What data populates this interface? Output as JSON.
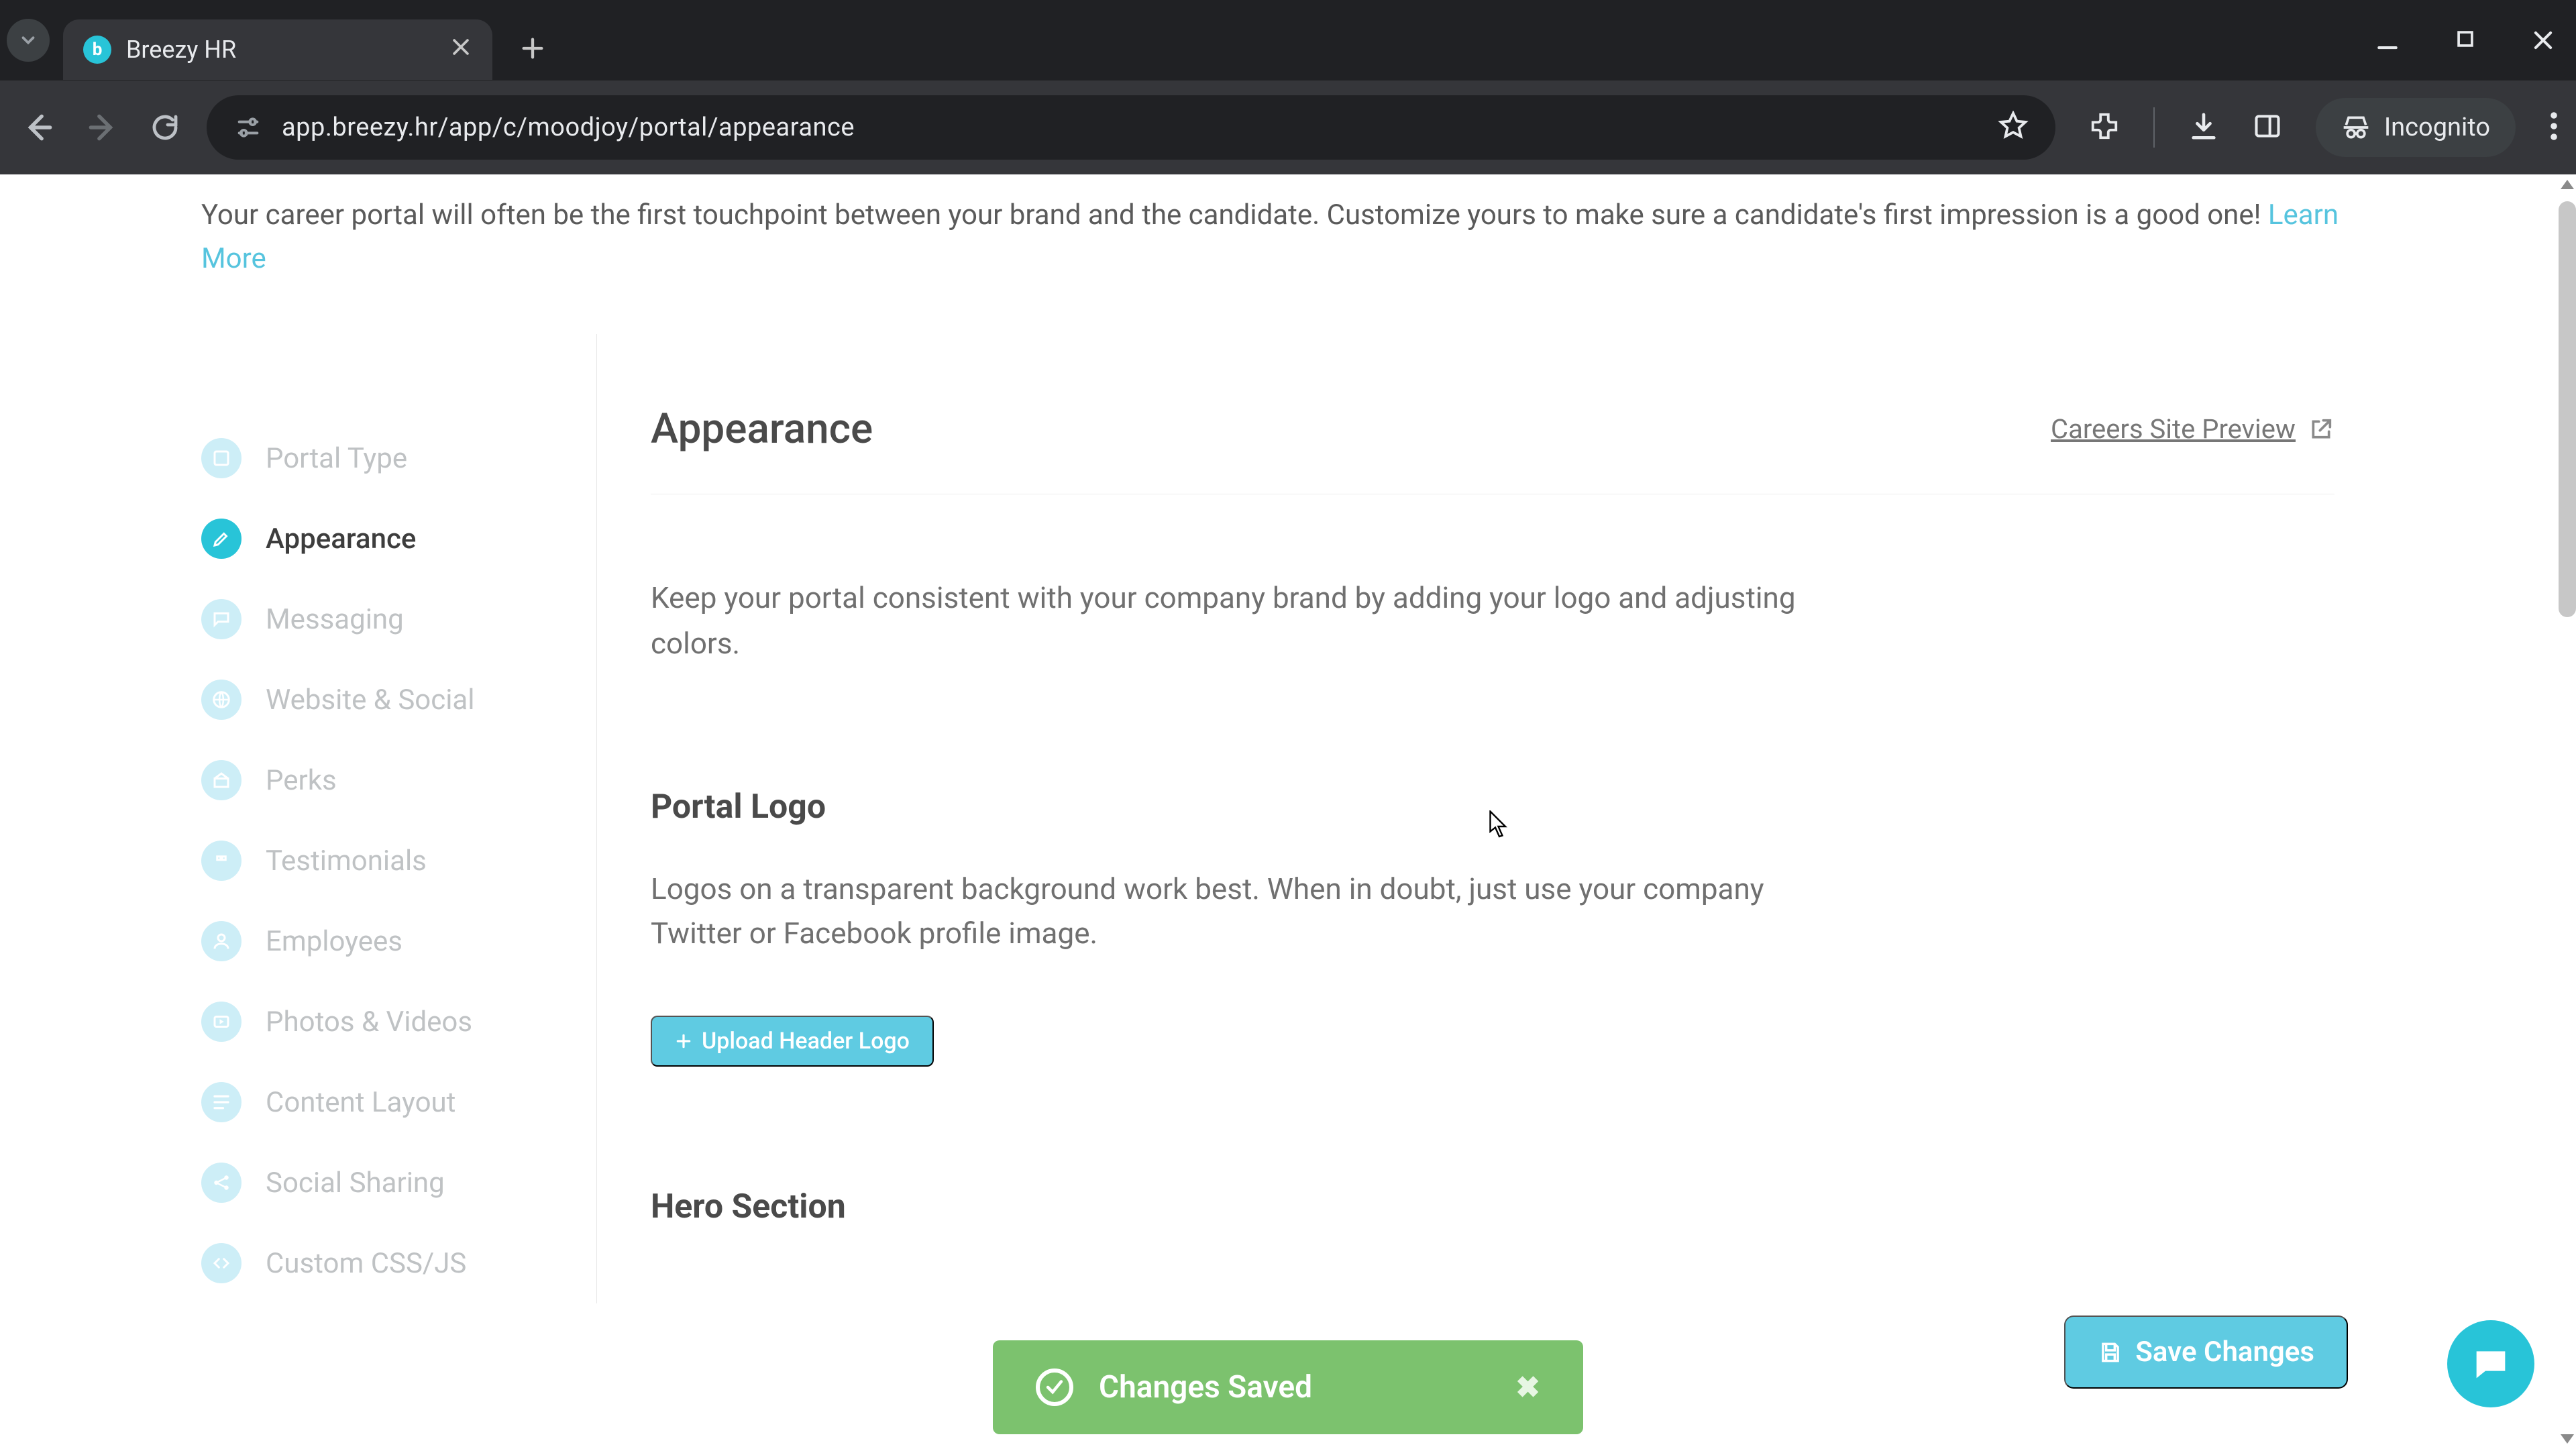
{
  "browser": {
    "tab_title": "Breezy HR",
    "url": "app.breezy.hr/app/c/moodjoy/portal/appearance",
    "incognito_label": "Incognito"
  },
  "intro": {
    "text": "Your career portal will often be the first touchpoint between your brand and the candidate. Customize yours to make sure a candidate's first impression is a good one! ",
    "learn_more": "Learn More"
  },
  "sidebar": {
    "items": [
      {
        "label": "Portal Type"
      },
      {
        "label": "Appearance"
      },
      {
        "label": "Messaging"
      },
      {
        "label": "Website & Social"
      },
      {
        "label": "Perks"
      },
      {
        "label": "Testimonials"
      },
      {
        "label": "Employees"
      },
      {
        "label": "Photos & Videos"
      },
      {
        "label": "Content Layout"
      },
      {
        "label": "Social Sharing"
      },
      {
        "label": "Custom CSS/JS"
      }
    ],
    "active_index": 1
  },
  "main": {
    "title": "Appearance",
    "preview_link": "Careers Site Preview",
    "intro_paragraph": "Keep your portal consistent with your company brand by adding your logo and adjusting colors.",
    "portal_logo_title": "Portal Logo",
    "portal_logo_text": "Logos on a transparent background work best. When in doubt, just use your company Twitter or Facebook profile image.",
    "upload_button": "Upload Header Logo",
    "hero_title": "Hero Section"
  },
  "toast": {
    "text": "Changes Saved"
  },
  "save_button": "Save Changes",
  "colors": {
    "brand": "#28c4d8",
    "brand_light": "#5fcbe2",
    "toast_green": "#7cc26e"
  }
}
